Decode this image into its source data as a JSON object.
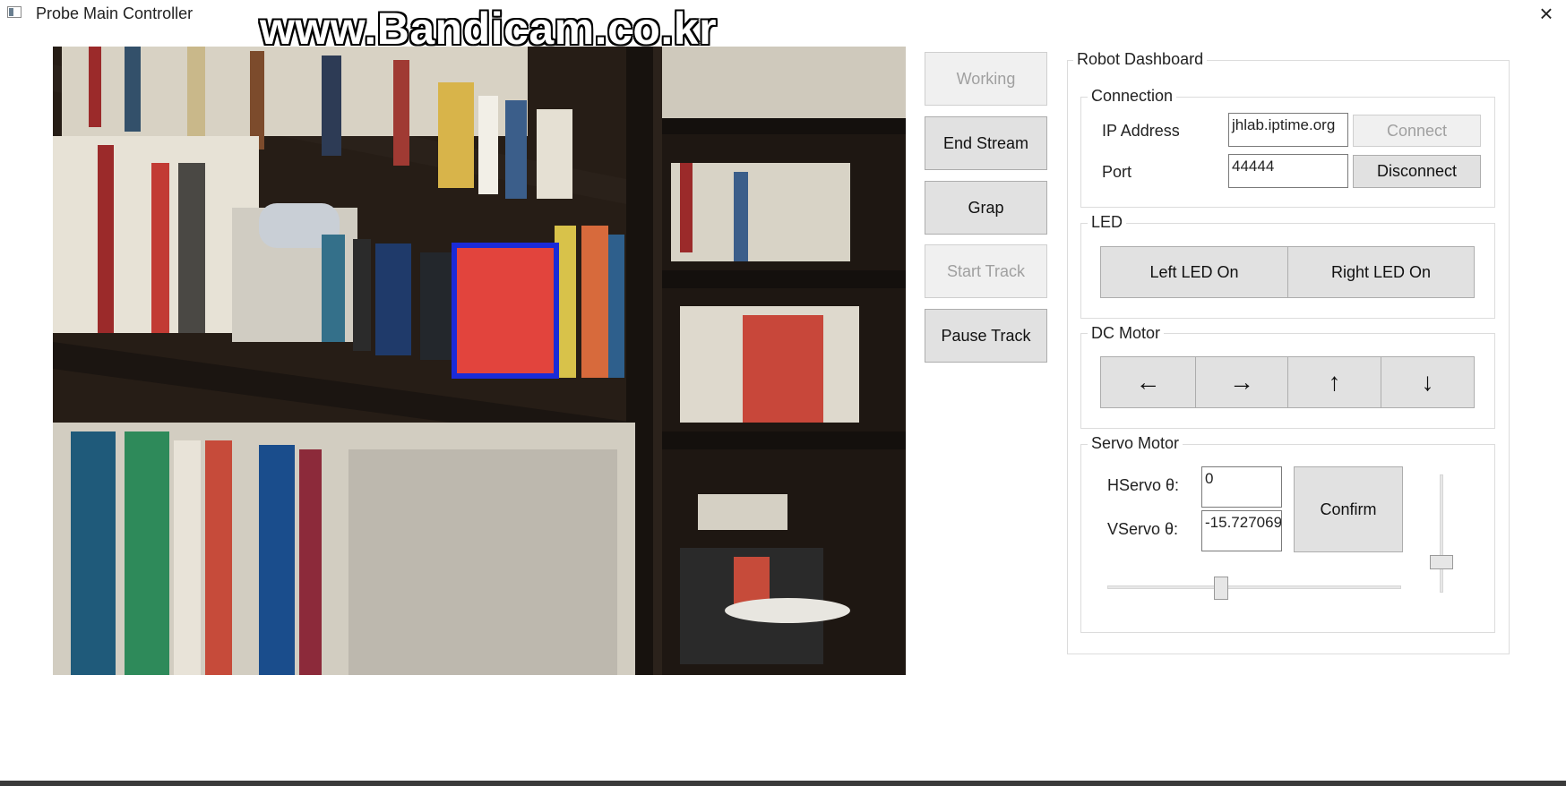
{
  "window": {
    "title": "Probe Main Controller",
    "watermark": "www.Bandicam.co.kr"
  },
  "stream_buttons": {
    "working": "Working",
    "end_stream": "End Stream",
    "grap": "Grap",
    "start_track": "Start Track",
    "pause_track": "Pause Track"
  },
  "dashboard": {
    "title": "Robot Dashboard",
    "connection": {
      "title": "Connection",
      "ip_label": "IP Address",
      "ip_value": "jhlab.iptime.org",
      "port_label": "Port",
      "port_value": "44444",
      "connect": "Connect",
      "disconnect": "Disconnect"
    },
    "led": {
      "title": "LED",
      "left": "Left LED On",
      "right": "Right LED On"
    },
    "dc_motor": {
      "title": "DC Motor",
      "left": "←",
      "right": "→",
      "up": "↑",
      "down": "↓"
    },
    "servo": {
      "title": "Servo Motor",
      "h_label": "HServo θ:",
      "h_value": "0",
      "v_label": "VServo θ:",
      "v_value": "-15.727069",
      "confirm": "Confirm",
      "h_slider_fraction": 0.38,
      "v_slider_fraction": 0.75
    }
  }
}
